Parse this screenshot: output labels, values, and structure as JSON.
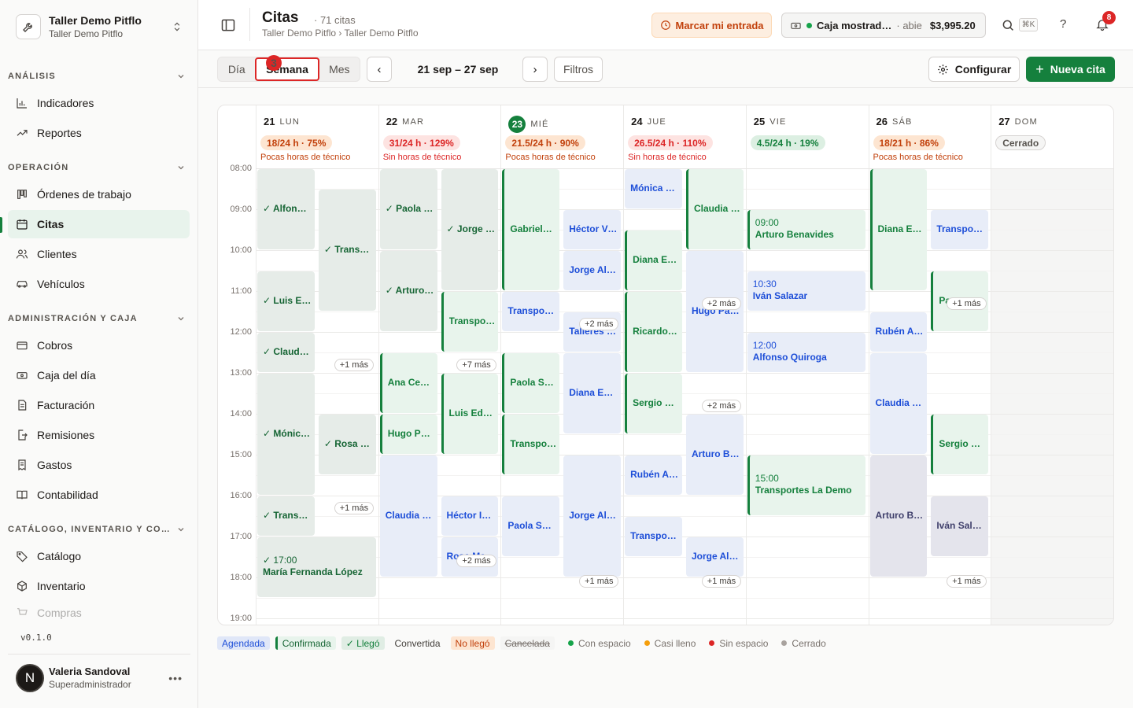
{
  "workspace": {
    "name": "Taller Demo Pitflo",
    "sub": "Taller Demo Pitflo"
  },
  "nav": {
    "sections": [
      {
        "label": "ANÁLISIS"
      },
      {
        "label": "OPERACIÓN"
      },
      {
        "label": "ADMINISTRACIÓN Y CAJA"
      },
      {
        "label": "CATÁLOGO, INVENTARIO Y CO…"
      }
    ],
    "items": [
      {
        "label": "Indicadores",
        "icon": "bar-chart-icon"
      },
      {
        "label": "Reportes",
        "icon": "trend-icon"
      },
      {
        "label": "Órdenes de trabajo",
        "icon": "kanban-icon"
      },
      {
        "label": "Citas",
        "icon": "calendar-icon"
      },
      {
        "label": "Clientes",
        "icon": "users-icon"
      },
      {
        "label": "Vehículos",
        "icon": "car-icon"
      },
      {
        "label": "Cobros",
        "icon": "card-icon"
      },
      {
        "label": "Caja del día",
        "icon": "cash-icon"
      },
      {
        "label": "Facturación",
        "icon": "invoice-icon"
      },
      {
        "label": "Remisiones",
        "icon": "export-icon"
      },
      {
        "label": "Gastos",
        "icon": "receipt-icon"
      },
      {
        "label": "Contabilidad",
        "icon": "book-icon"
      },
      {
        "label": "Catálogo",
        "icon": "tag-icon"
      },
      {
        "label": "Inventario",
        "icon": "box-icon"
      },
      {
        "label": "Compras",
        "icon": "cart-icon"
      }
    ]
  },
  "version": "v0.1.0",
  "user": {
    "initial": "N",
    "name": "Valeria Sandoval",
    "role": "Superadministrador"
  },
  "header": {
    "title": "Citas",
    "count": "· 71 citas",
    "breadcrumb": "Taller Demo Pitflo › Taller Demo Pitflo",
    "entrada": "Marcar mi entrada",
    "caja_label": "Caja mostrad…",
    "caja_status": "· abie",
    "caja_amount": "$3,995.20",
    "kbd": "⌘K",
    "help": "?",
    "notif_count": "8"
  },
  "toolbar": {
    "views": [
      "Día",
      "Semana",
      "Mes"
    ],
    "view_badge": "3",
    "prev": "‹",
    "next": "›",
    "range": "21 sep – 27 sep",
    "filters": "Filtros",
    "configure": "Configurar",
    "new": "Nueva cita"
  },
  "times": [
    "08:00",
    "09:00",
    "10:00",
    "11:00",
    "12:00",
    "13:00",
    "14:00",
    "15:00",
    "16:00",
    "17:00",
    "18:00",
    "19:00"
  ],
  "days": [
    {
      "num": "21",
      "name": "LUN",
      "cap": "18/24 h · 75%",
      "tone": "or",
      "note": "Pocas horas de técnico"
    },
    {
      "num": "22",
      "name": "MAR",
      "cap": "31/24 h · 129%",
      "tone": "rd",
      "note": "Sin horas de técnico"
    },
    {
      "num": "23",
      "name": "MIÉ",
      "cap": "21.5/24 h · 90%",
      "tone": "or",
      "note": "Pocas horas de técnico"
    },
    {
      "num": "24",
      "name": "JUE",
      "cap": "26.5/24 h · 110%",
      "tone": "rd",
      "note": "Sin horas de técnico"
    },
    {
      "num": "25",
      "name": "VIE",
      "cap": "4.5/24 h · 19%",
      "tone": "gr",
      "note": ""
    },
    {
      "num": "26",
      "name": "SÁB",
      "cap": "18/21 h · 86%",
      "tone": "or",
      "note": "Pocas horas de técnico"
    },
    {
      "num": "27",
      "name": "DOM",
      "cap": "Cerrado",
      "tone": "cl",
      "note": ""
    }
  ],
  "events": [
    {
      "d": 0,
      "s": 0,
      "st": 0,
      "en": 2,
      "k": "llego",
      "t": "✓ Alfons…"
    },
    {
      "d": 0,
      "s": 1,
      "st": 0.5,
      "en": 3.5,
      "k": "llego",
      "t": "✓ Trans…"
    },
    {
      "d": 0,
      "s": 0,
      "st": 2.5,
      "en": 4,
      "k": "llego",
      "t": "✓ Luis E…"
    },
    {
      "d": 0,
      "s": 0,
      "st": 4,
      "en": 5,
      "k": "llego",
      "t": "✓ Claudi…"
    },
    {
      "d": 0,
      "s": 0,
      "st": 5,
      "en": 8,
      "k": "llego",
      "t": "✓ Mónic…"
    },
    {
      "d": 0,
      "s": 1,
      "st": 6,
      "en": 7.5,
      "k": "llego",
      "t": "✓ Rosa …"
    },
    {
      "d": 0,
      "s": 0,
      "st": 8,
      "en": 9,
      "k": "llego",
      "t": "✓ Trans…"
    },
    {
      "d": 0,
      "s": 2,
      "st": 9,
      "en": 10.5,
      "k": "llego",
      "t": "✓ 17:00",
      "t2": "María Fernanda López"
    },
    {
      "d": 1,
      "s": 0,
      "st": 0,
      "en": 2,
      "k": "llego",
      "t": "✓ Paola …"
    },
    {
      "d": 1,
      "s": 1,
      "st": 0,
      "en": 3,
      "k": "llego",
      "t": "✓ Jorge …"
    },
    {
      "d": 1,
      "s": 0,
      "st": 2,
      "en": 4,
      "k": "llego",
      "t": "✓ Arturo…"
    },
    {
      "d": 1,
      "s": 1,
      "st": 3,
      "en": 4.5,
      "k": "conf",
      "t": "Transpo…"
    },
    {
      "d": 1,
      "s": 0,
      "st": 4.5,
      "en": 6,
      "k": "conf",
      "t": "Ana Ceci…"
    },
    {
      "d": 1,
      "s": 1,
      "st": 5,
      "en": 7,
      "k": "conf",
      "t": "Luis Edu…"
    },
    {
      "d": 1,
      "s": 0,
      "st": 6,
      "en": 7,
      "k": "conf",
      "t": "Hugo Pa…"
    },
    {
      "d": 1,
      "s": 0,
      "st": 7,
      "en": 10,
      "k": "agend",
      "t": "Claudia …"
    },
    {
      "d": 1,
      "s": 1,
      "st": 8,
      "en": 9,
      "k": "agend",
      "t": "Héctor Iv…"
    },
    {
      "d": 1,
      "s": 1,
      "st": 9,
      "en": 10,
      "k": "agend",
      "t": "Rosa Mar…"
    },
    {
      "d": 2,
      "s": 0,
      "st": 0,
      "en": 3,
      "k": "conf",
      "t": "Gabriela…"
    },
    {
      "d": 2,
      "s": 1,
      "st": 1,
      "en": 2,
      "k": "agend",
      "t": "Héctor Vi…"
    },
    {
      "d": 2,
      "s": 1,
      "st": 2,
      "en": 3,
      "k": "agend",
      "t": "Jorge Al…"
    },
    {
      "d": 2,
      "s": 0,
      "st": 3,
      "en": 4,
      "k": "agend",
      "t": "Transpor…"
    },
    {
      "d": 2,
      "s": 1,
      "st": 3.5,
      "en": 4.5,
      "k": "agend",
      "t": "Talleres …"
    },
    {
      "d": 2,
      "s": 0,
      "st": 4.5,
      "en": 6,
      "k": "conf",
      "t": "Paola Sá…"
    },
    {
      "d": 2,
      "s": 1,
      "st": 4.5,
      "en": 6.5,
      "k": "agend",
      "t": "Diana Es…"
    },
    {
      "d": 2,
      "s": 0,
      "st": 6,
      "en": 7.5,
      "k": "conf",
      "t": "Transpo…"
    },
    {
      "d": 2,
      "s": 1,
      "st": 7,
      "en": 10,
      "k": "agend",
      "t": "Jorge Al…"
    },
    {
      "d": 2,
      "s": 0,
      "st": 8,
      "en": 9.5,
      "k": "agend",
      "t": "Paola Sá…"
    },
    {
      "d": 3,
      "s": 0,
      "st": 0,
      "en": 1,
      "k": "agend",
      "t": "Mónica T…"
    },
    {
      "d": 3,
      "s": 1,
      "st": 0,
      "en": 2,
      "k": "conf",
      "t": "Claudia …"
    },
    {
      "d": 3,
      "s": 0,
      "st": 1.5,
      "en": 3,
      "k": "conf",
      "t": "Diana Es…"
    },
    {
      "d": 3,
      "s": 1,
      "st": 2,
      "en": 5,
      "k": "agend",
      "t": "Hugo Pal…"
    },
    {
      "d": 3,
      "s": 0,
      "st": 3,
      "en": 5,
      "k": "conf",
      "t": "Ricardo …"
    },
    {
      "d": 3,
      "s": 0,
      "st": 5,
      "en": 6.5,
      "k": "conf",
      "t": "Sergio C…"
    },
    {
      "d": 3,
      "s": 1,
      "st": 6,
      "en": 8,
      "k": "agend",
      "t": "Arturo B…"
    },
    {
      "d": 3,
      "s": 0,
      "st": 7,
      "en": 8,
      "k": "agend",
      "t": "Rubén Al…"
    },
    {
      "d": 3,
      "s": 0,
      "st": 8.5,
      "en": 9.5,
      "k": "agend",
      "t": "Transpor…"
    },
    {
      "d": 3,
      "s": 1,
      "st": 9,
      "en": 10,
      "k": "agend",
      "t": "Jorge Al…"
    },
    {
      "d": 4,
      "s": 2,
      "st": 1,
      "en": 2,
      "k": "conf",
      "t": "09:00",
      "t2": "Arturo Benavides"
    },
    {
      "d": 4,
      "s": 2,
      "st": 2.5,
      "en": 3.5,
      "k": "agend",
      "t": "10:30",
      "t2": "Iván Salazar"
    },
    {
      "d": 4,
      "s": 2,
      "st": 4,
      "en": 5,
      "k": "agend",
      "t": "12:00",
      "t2": "Alfonso Quiroga"
    },
    {
      "d": 4,
      "s": 2,
      "st": 7,
      "en": 8.5,
      "k": "conf",
      "t": "15:00",
      "t2": "Transportes La Demo"
    },
    {
      "d": 5,
      "s": 0,
      "st": 0,
      "en": 3,
      "k": "conf",
      "t": "Diana Es…"
    },
    {
      "d": 5,
      "s": 1,
      "st": 1,
      "en": 2,
      "k": "agend",
      "t": "Transpor…"
    },
    {
      "d": 5,
      "s": 1,
      "st": 2.5,
      "en": 4,
      "k": "conf",
      "t": "Pa"
    },
    {
      "d": 5,
      "s": 0,
      "st": 3.5,
      "en": 4.5,
      "k": "agend",
      "t": "Rubén Al…"
    },
    {
      "d": 5,
      "s": 0,
      "st": 4.5,
      "en": 7,
      "k": "agend",
      "t": "Claudia …"
    },
    {
      "d": 5,
      "s": 1,
      "st": 6,
      "en": 7.5,
      "k": "conf",
      "t": "Sergio C…"
    },
    {
      "d": 5,
      "s": 0,
      "st": 7,
      "en": 10,
      "k": "conv",
      "t": "Arturo B…"
    },
    {
      "d": 5,
      "s": 1,
      "st": 8,
      "en": 9.5,
      "k": "conv",
      "t": "Iván Sala…"
    }
  ],
  "more": [
    {
      "d": 0,
      "at": 4.8,
      "t": "+1 más"
    },
    {
      "d": 0,
      "at": 8.3,
      "t": "+1 más"
    },
    {
      "d": 1,
      "at": 4.8,
      "t": "+7 más"
    },
    {
      "d": 1,
      "at": 9.6,
      "t": "+2 más"
    },
    {
      "d": 2,
      "at": 3.8,
      "t": "+2 más"
    },
    {
      "d": 2,
      "at": 10.1,
      "t": "+1 más"
    },
    {
      "d": 3,
      "at": 3.3,
      "t": "+2 más"
    },
    {
      "d": 3,
      "at": 5.8,
      "t": "+2 más"
    },
    {
      "d": 3,
      "at": 10.1,
      "t": "+1 más"
    },
    {
      "d": 5,
      "at": 3.3,
      "t": "+1 más"
    },
    {
      "d": 5,
      "at": 10.1,
      "t": "+1 más"
    }
  ],
  "legend": {
    "statuses": [
      "Agendada",
      "Confirmada",
      "✓ Llegó",
      "Convertida",
      "No llegó",
      "Cancelada"
    ],
    "capacity": [
      {
        "label": "Con espacio",
        "color": "#16a34a"
      },
      {
        "label": "Casi lleno",
        "color": "#f59e0b"
      },
      {
        "label": "Sin espacio",
        "color": "#dc2626"
      },
      {
        "label": "Cerrado",
        "color": "#a8a29e"
      }
    ]
  }
}
